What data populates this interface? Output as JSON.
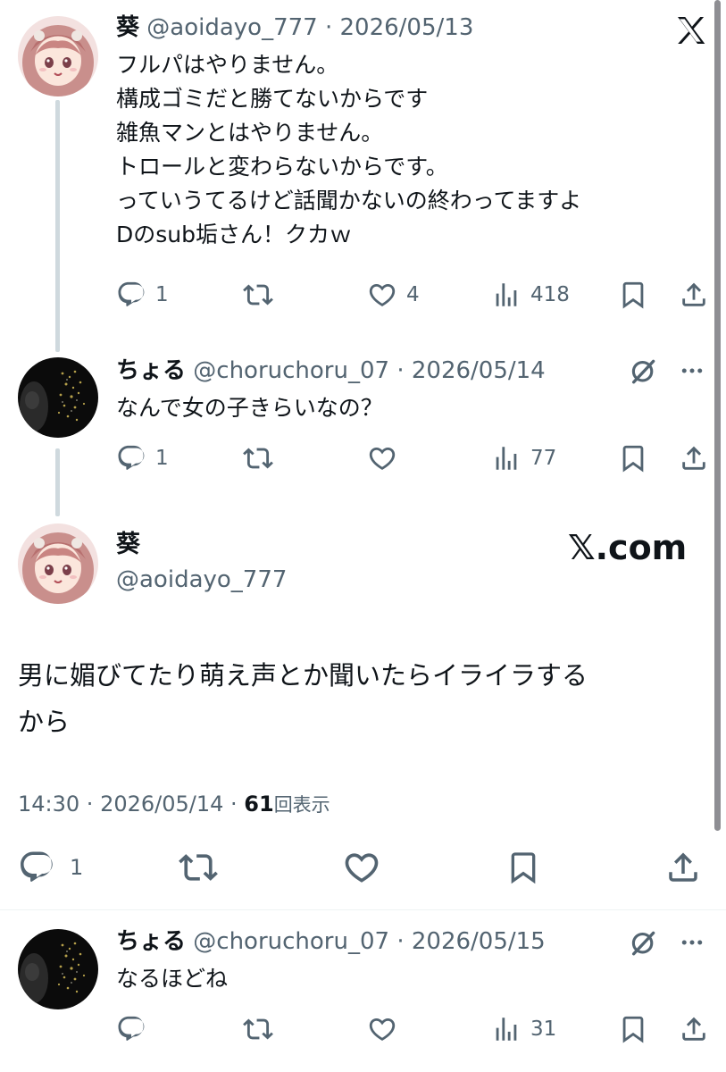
{
  "tweet1": {
    "name": "葵",
    "handle": "@aoidayo_777",
    "sep": " · ",
    "date": "2026/05/13",
    "lines": [
      "フルパはやりません。",
      "構成ゴミだと勝てないからです",
      "雑魚マンとはやりません。",
      "トロールと変わらないからです。",
      "っていうてるけど話聞かないの終わってますよ",
      "Dのsub垢さん！クカｗ"
    ],
    "replies": "1",
    "likes": "4",
    "views": "418"
  },
  "tweet2": {
    "name": "ちょる",
    "handle": "@choruchoru_07",
    "sep": " · ",
    "date": "2026/05/14",
    "text": "なんで女の子きらいなの？",
    "replies": "1",
    "views": "77"
  },
  "main": {
    "name": "葵",
    "handle": "@aoidayo_777",
    "brand": "𝕏.com",
    "text_line1": "男に媚びてたり萌え声とか聞いたらイライラする",
    "text_line2": "から",
    "time": "14:30",
    "sep": " · ",
    "date": "2026/05/14",
    "sep2": " · ",
    "views": "61",
    "views_label": "回表示",
    "replies": "1"
  },
  "tweet3": {
    "name": "ちょる",
    "handle": "@choruchoru_07",
    "sep": " · ",
    "date": "2026/05/15",
    "text": "なるほどね",
    "views": "31"
  },
  "colors": {
    "text": "#0f1419",
    "muted": "#536471",
    "thread_line": "#cfd9de"
  },
  "icons": [
    "x-logo-icon",
    "reply-icon",
    "retweet-icon",
    "like-icon",
    "views-icon",
    "bookmark-icon",
    "share-icon",
    "grok-icon",
    "more-icon"
  ]
}
